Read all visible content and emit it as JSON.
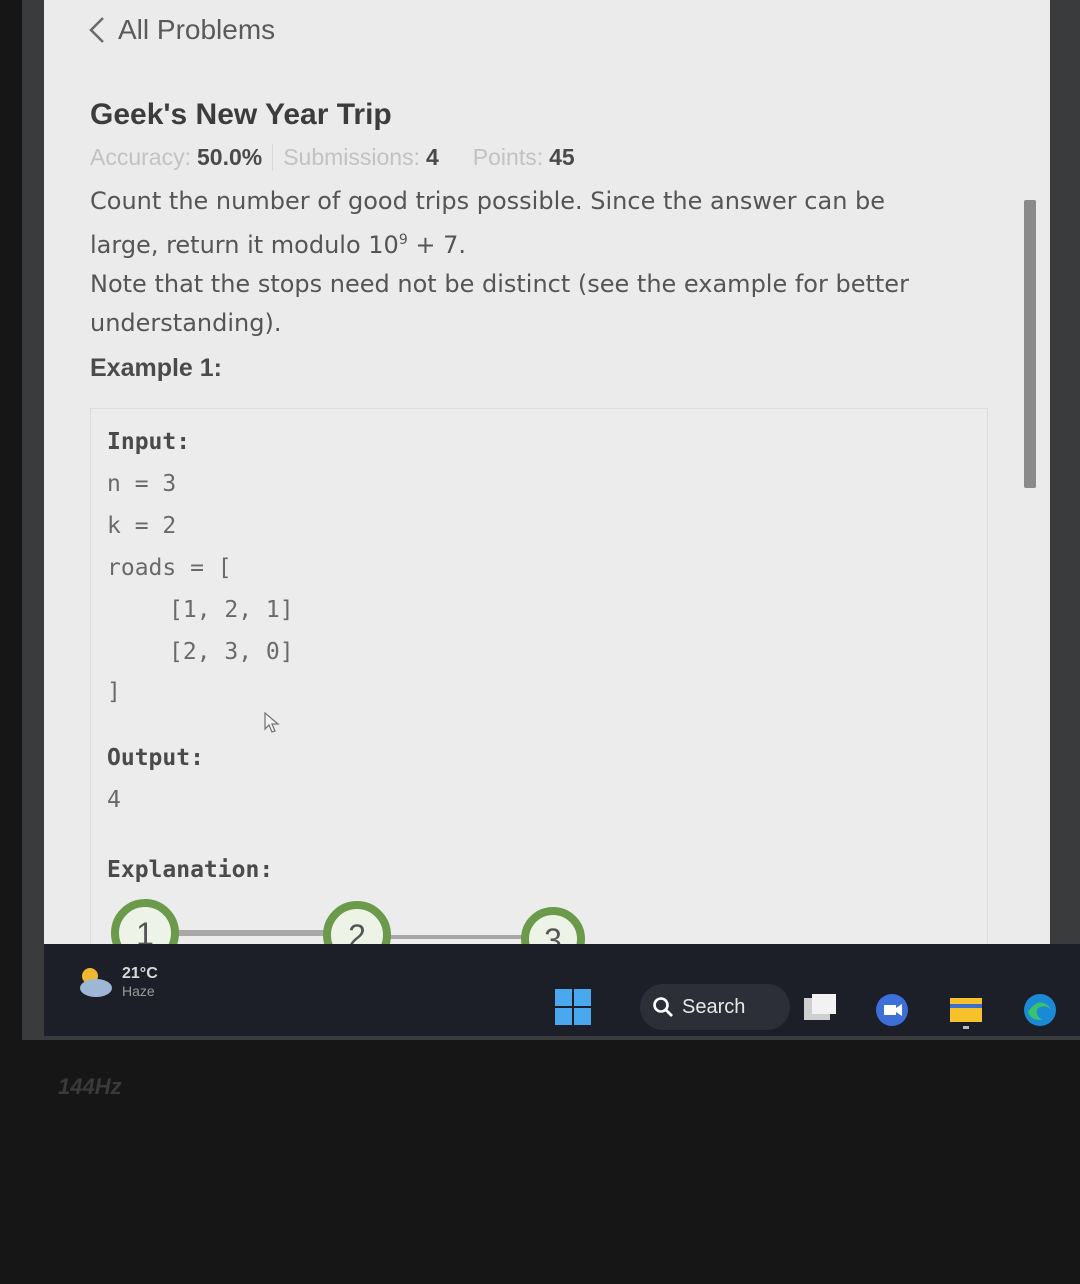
{
  "nav": {
    "back_label": "All Problems"
  },
  "problem": {
    "title": "Geek's New Year Trip",
    "accuracy_label": "Accuracy:",
    "accuracy_value": "50.0%",
    "submissions_label": "Submissions:",
    "submissions_value": "4",
    "points_label": "Points:",
    "points_value": "45",
    "desc_line1": "Count the number of good trips possible. Since the answer can be",
    "desc_line2_pre": "large, return it modulo 10",
    "desc_line2_sup": "9",
    "desc_line2_post": " + 7.",
    "desc_line3": "Note that the stops need not be distinct (see the example for better",
    "desc_line4": "understanding)."
  },
  "example": {
    "heading": "Example 1:",
    "input_label": "Input:",
    "lines": [
      "n = 3",
      "k = 2",
      "roads = [",
      "[1, 2, 1]",
      "[2, 3, 0]",
      "]"
    ],
    "output_label": "Output:",
    "output_value": "4",
    "explanation_label": "Explanation:",
    "nodes": [
      "1",
      "2",
      "3"
    ]
  },
  "taskbar": {
    "temperature": "21°C",
    "condition": "Haze",
    "search_label": "Search",
    "icons": [
      "windows-start-icon",
      "search-icon",
      "task-view-icon",
      "meet-icon",
      "file-explorer-icon",
      "edge-icon"
    ]
  },
  "monitor_badge": "144Hz",
  "colors": {
    "page_bg": "#ebebeb",
    "node_green": "#6a9a4a",
    "taskbar_bg": "#1c1f27"
  }
}
